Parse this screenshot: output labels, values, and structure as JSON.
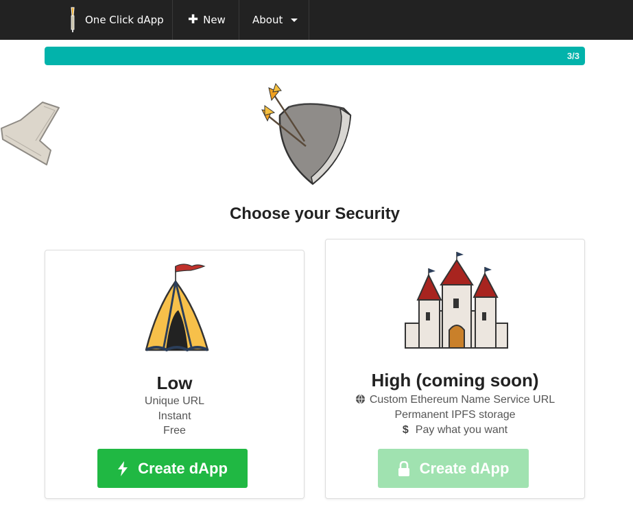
{
  "navbar": {
    "brand": "One Click dApp",
    "new_label": "New",
    "about_label": "About"
  },
  "progress": {
    "text": "3/3",
    "fraction": 1.0
  },
  "heading": "Choose your Security",
  "cards": {
    "low": {
      "title": "Low",
      "lines": [
        "Unique URL",
        "Instant",
        "Free"
      ],
      "button_label": "Create dApp",
      "button_icon": "lightning-bolt-icon"
    },
    "high": {
      "title": "High (coming soon)",
      "lines": [
        "Custom Ethereum Name Service URL",
        "Permanent IPFS storage",
        "Pay what you want"
      ],
      "line_icons": [
        "globe-icon",
        "",
        "dollar-icon"
      ],
      "button_label": "Create dApp",
      "button_icon": "lock-icon"
    }
  },
  "colors": {
    "navbar": "#222222",
    "progress": "#02b3ab",
    "button_primary": "#20b843",
    "button_disabled": "#a0e2b0"
  }
}
